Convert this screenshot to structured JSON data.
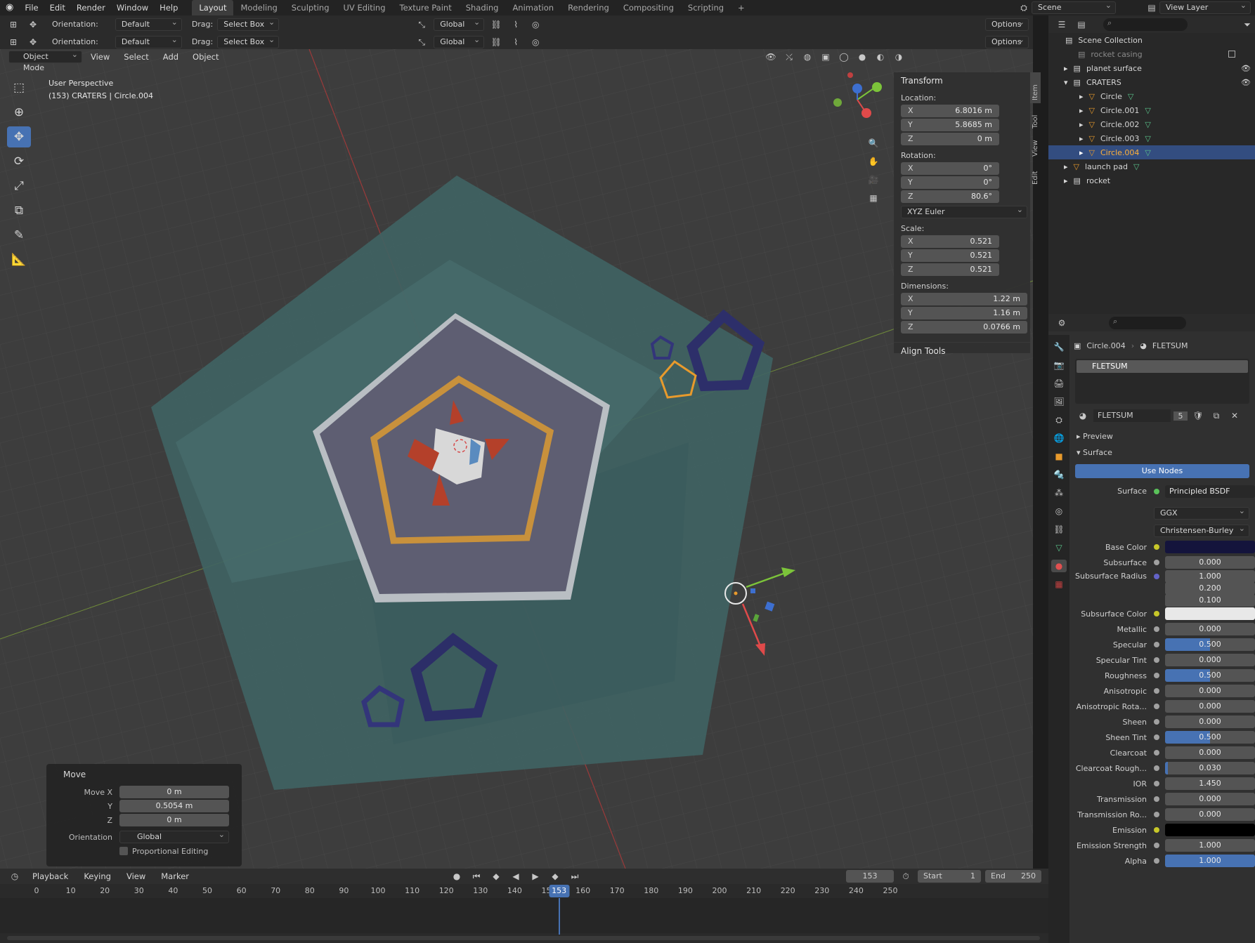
{
  "topbar": {
    "menus": [
      "File",
      "Edit",
      "Render",
      "Window",
      "Help"
    ],
    "workspaces": [
      "Layout",
      "Modeling",
      "Sculpting",
      "UV Editing",
      "Texture Paint",
      "Shading",
      "Animation",
      "Rendering",
      "Compositing",
      "Scripting"
    ],
    "active_workspace": "Layout",
    "scene": "Scene",
    "view_layer": "View Layer"
  },
  "tool_header": {
    "orientation_label": "Orientation:",
    "orientation_value": "Default",
    "drag_label": "Drag:",
    "drag_value": "Select Box",
    "transform_orientation": "Global",
    "options": "Options"
  },
  "view_header": {
    "mode": "Object Mode",
    "menus": [
      "View",
      "Select",
      "Add",
      "Object"
    ]
  },
  "viewport": {
    "title": "User Perspective",
    "subtitle": "(153) CRATERS | Circle.004"
  },
  "npanel": {
    "title": "Transform",
    "tabs": [
      "Item",
      "Tool",
      "View",
      "Edit"
    ],
    "location_label": "Location:",
    "location": {
      "x": "6.8016 m",
      "y": "5.8685 m",
      "z": "0 m"
    },
    "rotation_label": "Rotation:",
    "rotation": {
      "x": "0°",
      "y": "0°",
      "z": "80.6°"
    },
    "rotation_mode": "XYZ Euler",
    "scale_label": "Scale:",
    "scale": {
      "x": "0.521",
      "y": "0.521",
      "z": "0.521"
    },
    "dimensions_label": "Dimensions:",
    "dimensions": {
      "x": "1.22 m",
      "y": "1.16 m",
      "z": "0.0766 m"
    },
    "align_tools": "Align Tools"
  },
  "outliner": {
    "root": "Scene Collection",
    "items": [
      "rocket casing",
      "planet surface",
      "CRATERS",
      "Circle",
      "Circle.001",
      "Circle.002",
      "Circle.003",
      "Circle.004",
      "launch pad",
      "rocket"
    ]
  },
  "properties": {
    "object": "Circle.004",
    "material": "FLETSUM",
    "slot": "FLETSUM",
    "material_users": "5",
    "preview": "Preview",
    "surface_section": "Surface",
    "use_nodes": "Use Nodes",
    "surface_label": "Surface",
    "surface_shader": "Principled BSDF",
    "distribution": "GGX",
    "subsurface_method": "Christensen-Burley",
    "rows": [
      {
        "label": "Base Color",
        "value": "",
        "fraction": 0
      },
      {
        "label": "Subsurface",
        "value": "0.000",
        "fraction": 0
      },
      {
        "label": "Subsurface Radius",
        "value": "1.000",
        "fraction": 0
      },
      {
        "label": "",
        "value": "0.200",
        "fraction": 0
      },
      {
        "label": "",
        "value": "0.100",
        "fraction": 0
      },
      {
        "label": "Subsurface Color",
        "value": "",
        "fraction": 0
      },
      {
        "label": "Metallic",
        "value": "0.000",
        "fraction": 0
      },
      {
        "label": "Specular",
        "value": "0.500",
        "fraction": 0.5
      },
      {
        "label": "Specular Tint",
        "value": "0.000",
        "fraction": 0
      },
      {
        "label": "Roughness",
        "value": "0.500",
        "fraction": 0.5
      },
      {
        "label": "Anisotropic",
        "value": "0.000",
        "fraction": 0
      },
      {
        "label": "Anisotropic Rota...",
        "value": "0.000",
        "fraction": 0
      },
      {
        "label": "Sheen",
        "value": "0.000",
        "fraction": 0
      },
      {
        "label": "Sheen Tint",
        "value": "0.500",
        "fraction": 0.5
      },
      {
        "label": "Clearcoat",
        "value": "0.000",
        "fraction": 0
      },
      {
        "label": "Clearcoat Rough...",
        "value": "0.030",
        "fraction": 0.03
      },
      {
        "label": "IOR",
        "value": "1.450",
        "fraction": 0
      },
      {
        "label": "Transmission",
        "value": "0.000",
        "fraction": 0
      },
      {
        "label": "Transmission Ro...",
        "value": "0.000",
        "fraction": 0
      },
      {
        "label": "Emission",
        "value": "",
        "fraction": 0
      },
      {
        "label": "Emission Strength",
        "value": "1.000",
        "fraction": 0
      },
      {
        "label": "Alpha",
        "value": "1.000",
        "fraction": 1
      }
    ]
  },
  "move_panel": {
    "title": "Move",
    "move_x_label": "Move X",
    "move_x": "0 m",
    "y_label": "Y",
    "y": "0.5054 m",
    "z_label": "Z",
    "z": "0 m",
    "orientation_label": "Orientation",
    "orientation": "Global",
    "proportional": "Proportional Editing"
  },
  "timeline": {
    "menus": [
      "Playback",
      "Keying",
      "View",
      "Marker"
    ],
    "current_frame": "153",
    "start_label": "Start",
    "start": "1",
    "end_label": "End",
    "end": "250",
    "ticks": [
      "0",
      "10",
      "20",
      "30",
      "40",
      "50",
      "60",
      "70",
      "80",
      "90",
      "100",
      "110",
      "120",
      "130",
      "140",
      "150",
      "160",
      "170",
      "180",
      "190",
      "200",
      "210",
      "220",
      "230",
      "240",
      "250"
    ]
  },
  "colors": {
    "accent": "#4772b3",
    "selected_row": "#334d80",
    "base_color": "#14143c",
    "subsurface_color": "#e8e8e8",
    "emission": "#000000"
  }
}
